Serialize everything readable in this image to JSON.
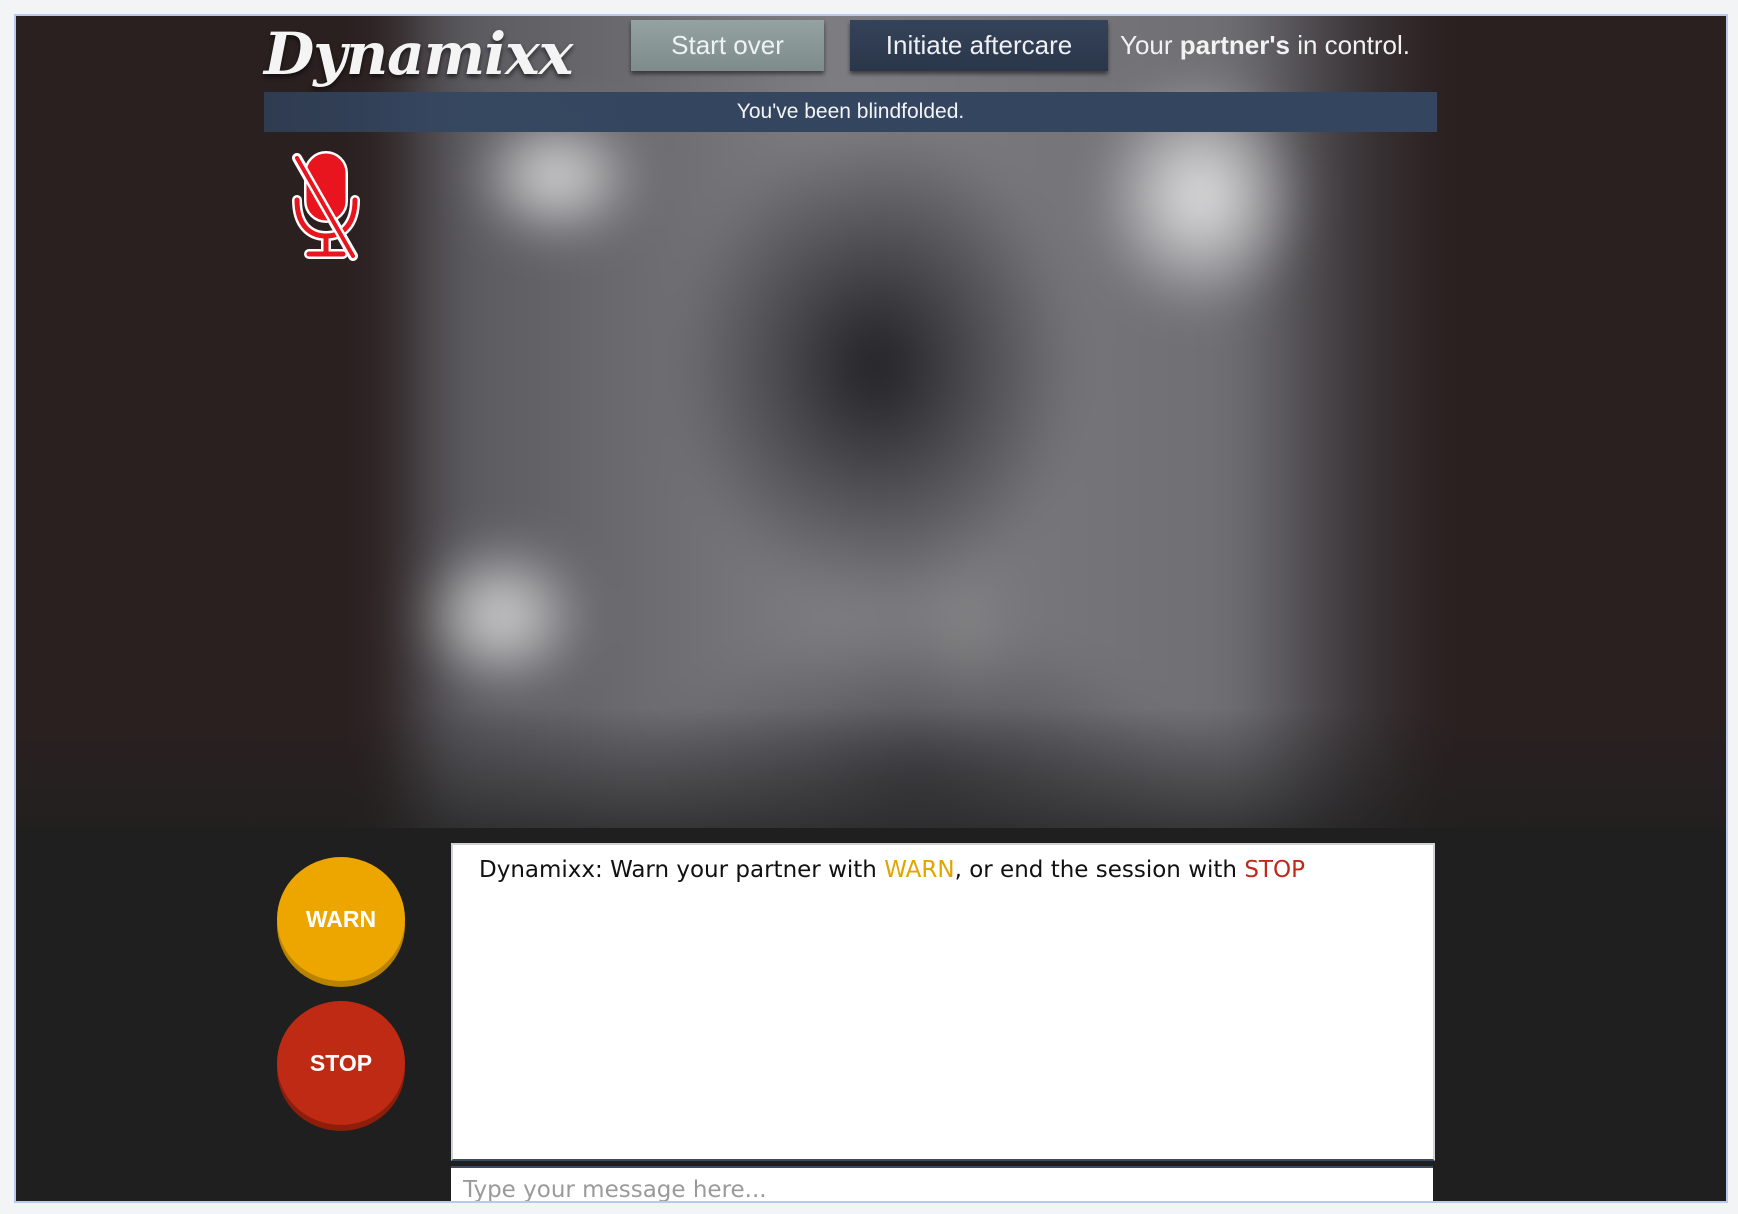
{
  "header": {
    "logo": "Dynamixx",
    "start_over_label": "Start over",
    "aftercare_label": "Initiate aftercare",
    "control_prefix": "Your ",
    "control_bold": "partner's",
    "control_suffix": " in control."
  },
  "banner": {
    "text": "You've been blindfolded."
  },
  "mic": {
    "icon": "microphone-muted-icon",
    "color": "#e8141e"
  },
  "buttons": {
    "warn_label": "WARN",
    "stop_label": "STOP",
    "warn_color": "#eda600",
    "stop_color": "#bf2a14"
  },
  "chat": {
    "message_prefix": "Dynamixx: Warn your partner with ",
    "message_warn": "WARN",
    "message_middle": ", or end the session with ",
    "message_stop": "STOP",
    "input_placeholder": "Type your message here..."
  }
}
